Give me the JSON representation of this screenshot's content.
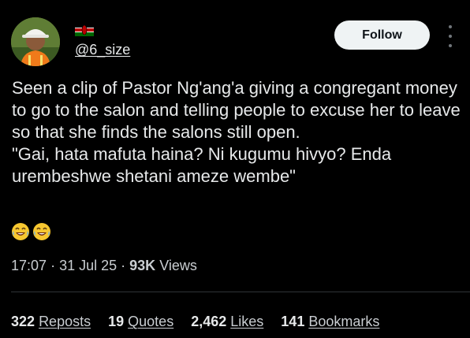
{
  "author": {
    "handle": "@6_size",
    "flag_icon": "kenya-flag-icon",
    "avatar_icon": "avatar-image"
  },
  "follow_label": "Follow",
  "more_icon": "more-vertical-icon",
  "post": {
    "text": "Seen a clip of Pastor Ng'ang'a giving a congregant money to go to the salon and telling people to excuse her to leave so that she finds the salons still open.\n\"Gai, hata mafuta haina? Ni kugumu hivyo? Enda urembeshwe shetani ameze wembe\"",
    "emoji": "😂😂"
  },
  "meta": {
    "time": "17:07",
    "date": "31 Jul 25",
    "views_count": "93K",
    "views_label": "Views"
  },
  "stats": {
    "reposts_count": "322",
    "reposts_label": "Reposts",
    "quotes_count": "19",
    "quotes_label": "Quotes",
    "likes_count": "2,462",
    "likes_label": "Likes",
    "bookmarks_count": "141",
    "bookmarks_label": "Bookmarks"
  },
  "colors": {
    "background": "#000000",
    "text": "#e7e9ea",
    "button": "#eff3f4"
  }
}
